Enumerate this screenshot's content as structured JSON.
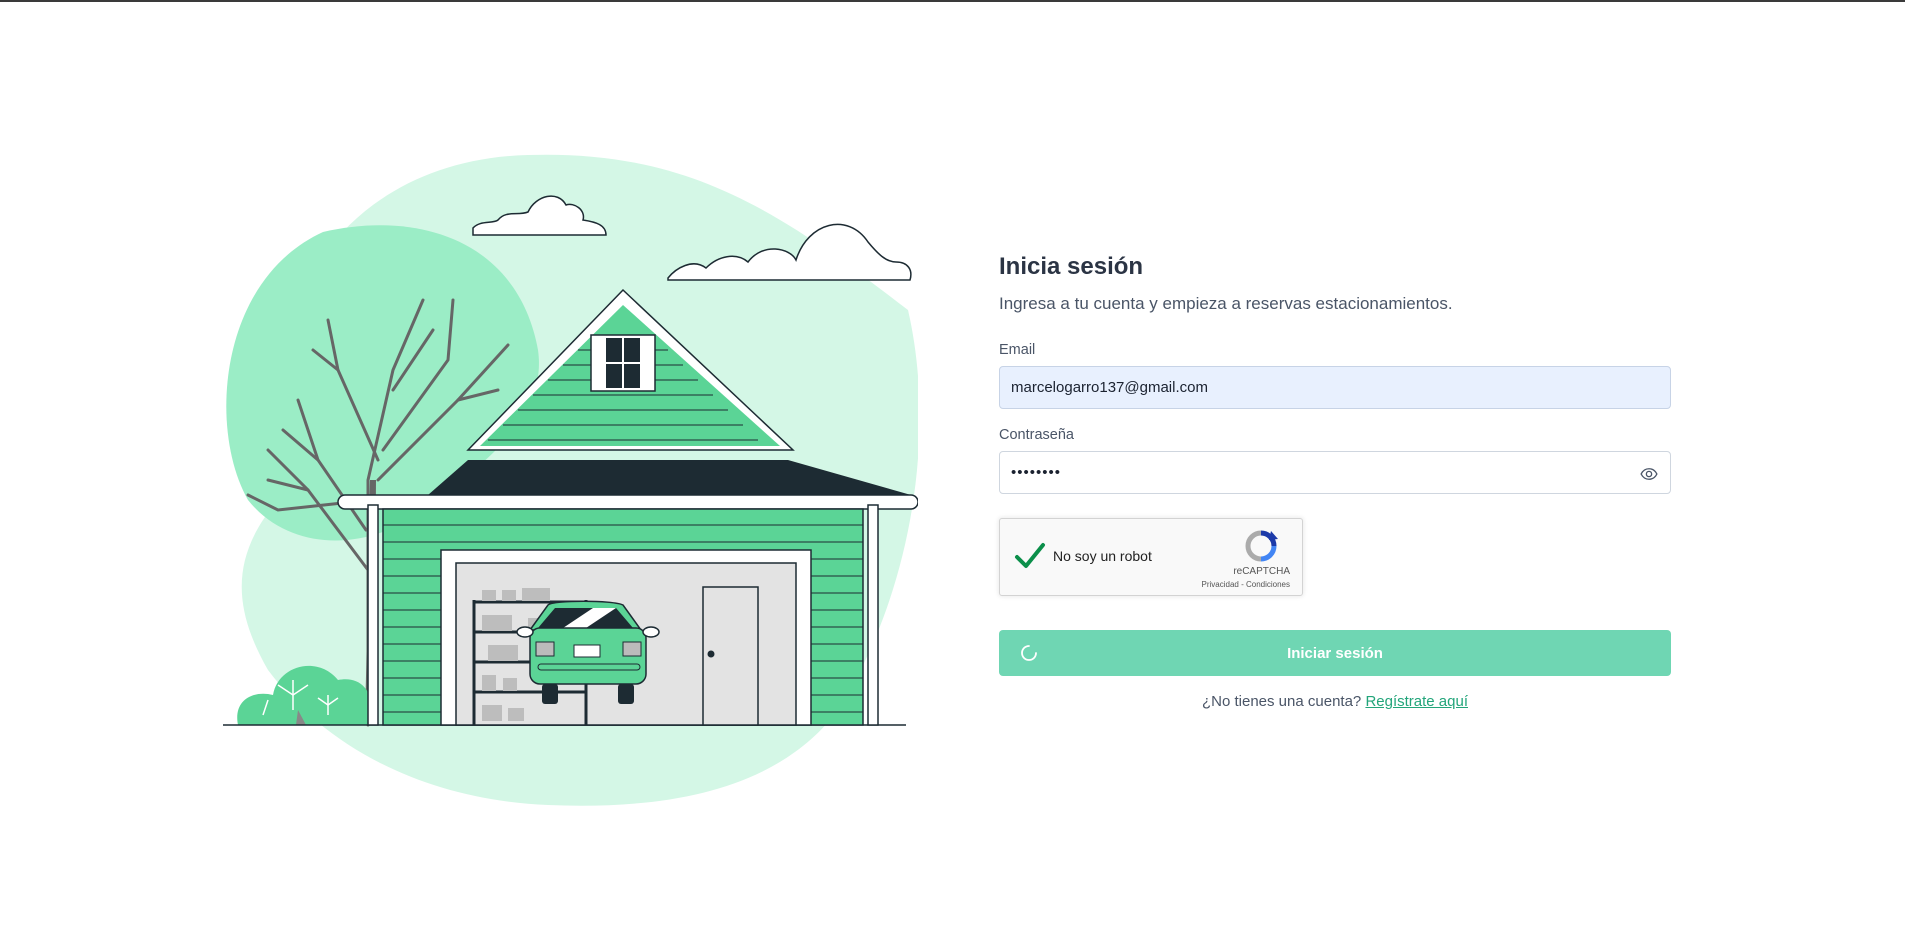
{
  "login": {
    "title": "Inicia sesión",
    "subtitle": "Ingresa a tu cuenta y empieza a reservas estacionamientos.",
    "email_label": "Email",
    "email_value": "marcelogarro137@gmail.com",
    "password_label": "Contraseña",
    "password_value": "••••••••",
    "submit_label": "Iniciar sesión",
    "signup_prompt": "¿No tienes una cuenta?",
    "signup_link": "Regístrate aquí"
  },
  "captcha": {
    "label": "No soy un robot",
    "brand": "reCAPTCHA",
    "links": "Privacidad - Condiciones",
    "checked": true
  },
  "colors": {
    "accent": "#6fd6b3",
    "link": "#22a57a",
    "house_green": "#5bd496",
    "roof_dark": "#1d2b33",
    "blob_light": "#d4f7e6"
  }
}
